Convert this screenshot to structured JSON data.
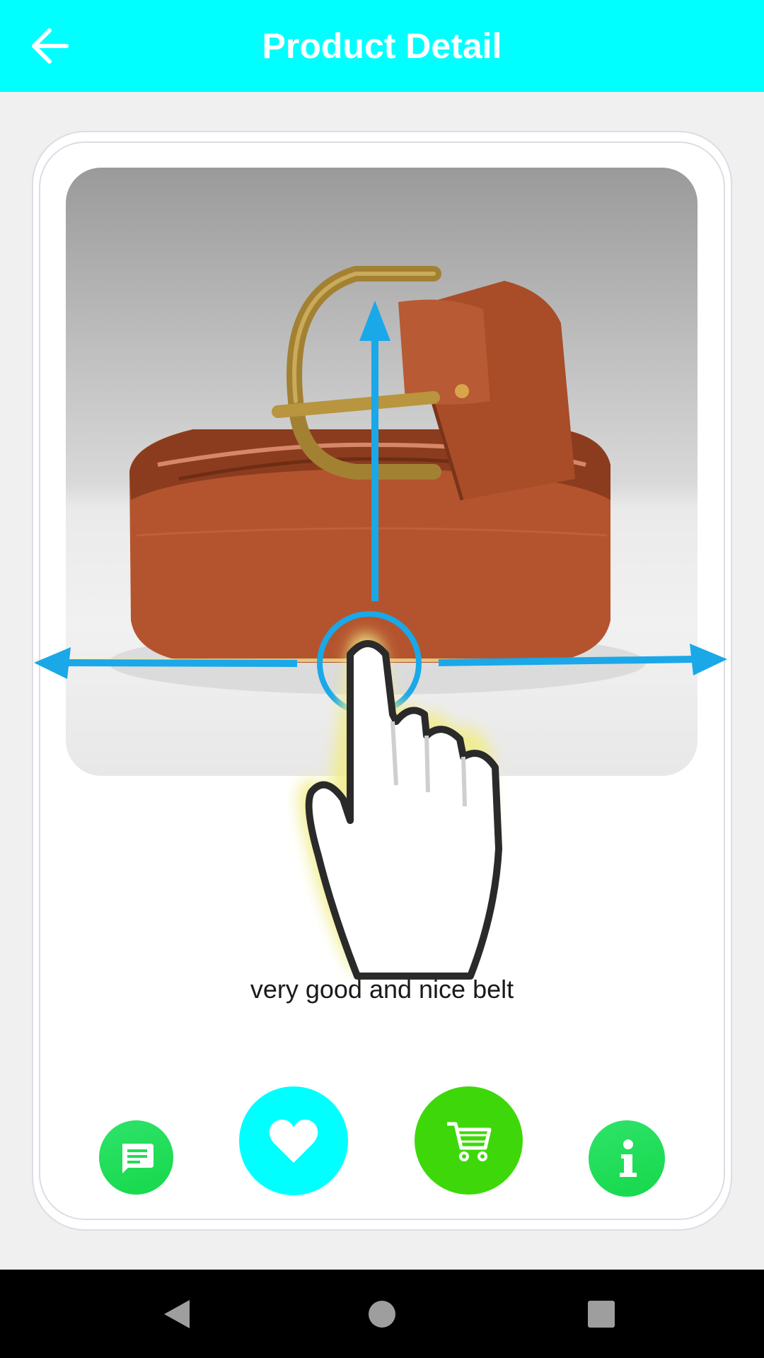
{
  "header": {
    "title": "Product Detail",
    "back_icon": "arrow-left-icon",
    "background_color": "#00ffff"
  },
  "product": {
    "image_alt": "brown leather belt with brass buckle",
    "description": "very good and nice belt"
  },
  "actions": [
    {
      "name": "chat",
      "icon": "chat-icon",
      "color": "#22dd55"
    },
    {
      "name": "favorite",
      "icon": "heart-icon",
      "color": "#00ffff"
    },
    {
      "name": "cart",
      "icon": "cart-icon",
      "color": "#3ed80a"
    },
    {
      "name": "info",
      "icon": "info-icon",
      "color": "#22dd55"
    }
  ],
  "gesture_hint": {
    "icon": "swipe-hand-icon",
    "arrow_color": "#1aa8e8"
  },
  "system_nav": {
    "buttons": [
      "back",
      "home",
      "recents"
    ]
  }
}
